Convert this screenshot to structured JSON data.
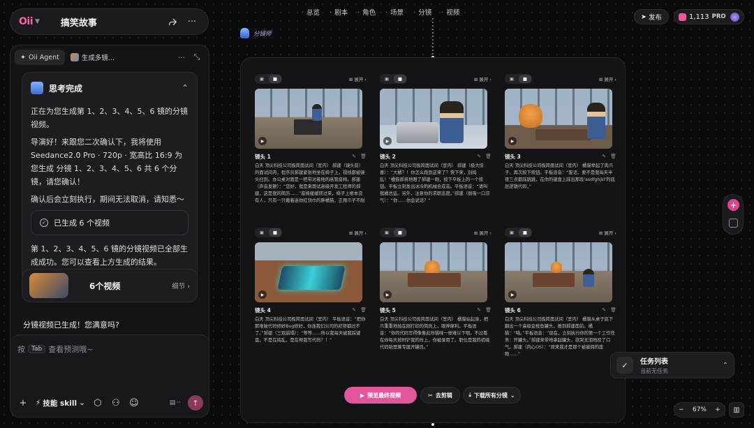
{
  "project": {
    "logo": "Oii",
    "title": "搞笑故事"
  },
  "agent": {
    "tabs": [
      {
        "label": "Oii Agent"
      },
      {
        "label": "生成多镜..."
      }
    ],
    "think_title": "思考完成",
    "messages": [
      "正在为您生成第 1、2、3、4、5、6 镜的分镜视频。",
      "导演好！来跟您二次确认下，我将使用 Seedance2.0 Pro · 720p · 宽高比 16:9 为您生成 分镜 1、2、3、4、5、6 共 6 个分镜，请您确认！",
      "确认后会立刻执行，期间无法取消，请知悉～"
    ],
    "done_label": "已生成 6 个视频",
    "result_text": "第 1、2、3、4、5、6 镜的分镜视频已全部生成成功。您可以查看上方生成的结果。",
    "video_card_label": "6个视频",
    "video_card_detail": "细节",
    "satisfy_text": "分镜视频已生成！您满意吗?",
    "input": {
      "hint_prefix": "按",
      "hint_key": "Tab",
      "hint_suffix": "查看预测哦~",
      "skill_label": "技能 skill"
    }
  },
  "top_nav": [
    "总览",
    "剧本",
    "角色",
    "场景",
    "分镜",
    "视频"
  ],
  "header": {
    "publish": "发布",
    "credits": "1,113",
    "pro": "PRO"
  },
  "storyboard_label": "分镜师",
  "shots": [
    {
      "title": "镜头 1",
      "expand": "展开",
      "desc": "白天 顶尖科技公司极简面试间（室内） 郝建（镜头前）的面试间内，程序员郝建紧张地坐在椅子上，视线都被镜头扫到。办公桌对面是一把带对着他的高管座椅。郝建（声音发颤）：“您好，我是来面试高级开发工程师的郝建，这是我的简历……”座椅缓缓转过来，椅子上根本没有人，只有一只戴着迷你红领巾的胖橘猫，正用爪子不耐烦地拍打着桌上的智能平板。"
    },
    {
      "title": "镜头 2",
      "expand": "展开",
      "desc": "白天 顶尖科技公司极简面试间（室内） 郝建（极大惊喜）：“大橘？！你怎么跑到这来了？快下来，别捣乱！”橘猫郝将地瞪了郝建一眼，按下平板上的一个按钮。平板立刻发出冰冷的机械合成音。平板语音：“请叫我橘总监。另外，注意你的求职态度。”郝建（倒吸一口凉气）：“你……你会说话？”"
    },
    {
      "title": "镜头 3",
      "expand": "展开",
      "desc": "白天 顶尖科技公司极简面试间（室内） 橘猫举起了肉爪子，再次按下按钮。平板语音：“废话，要不是我每天半夜三点都踩跳跳，在你的键盘上踩出那段'asdfghjkl'的底层逻辑代码，”"
    },
    {
      "title": "镜头 4",
      "expand": "展开",
      "desc": "白天 顶尖科技公司极简面试间（室内） 平板语音：“把你那堆破代码修好Bug修好，你连我们公司的初筛都过不了。”郝建（三观崩塌）：“等等……所以我每天被我踩键盘，不是在捣乱，是在帮我写代码？！”"
    },
    {
      "title": "镜头 5",
      "expand": "展开",
      "desc": "白天 顶尖科技公司极简面试间（室内） 橘猫站起身，把爪重重地拍在刚打印的简历上，眼神犀利。平板语音：“你的代码写得像像此所猫咪一样难以下咽。不过看在你每天按时铲我的份上，你被录用了。职位是我的初级代码助理兼专属开罐员。”"
    },
    {
      "title": "镜头 6",
      "expand": "展开",
      "desc": "白天 顶尖科技公司极简面试间（室内） 橘猫从桌子底下翻出一个高级金枪鱼罐头，推到郝建面前。橘猫：“喵。”平板语音：“现在，立刻执行你的第一个工作任务：开罐头。”郝建来带地拿起罐头，欲哭无泪地叹了口气。郝建（内心OS）：“原来我才是那个被雇佣的废物……”"
    }
  ],
  "actions": {
    "preview": "预览最终视频",
    "clip": "去剪辑",
    "download": "下载所有分镜"
  },
  "tasks": {
    "title": "任务列表",
    "empty": "当前无任务"
  },
  "zoom": {
    "level": "67%"
  }
}
